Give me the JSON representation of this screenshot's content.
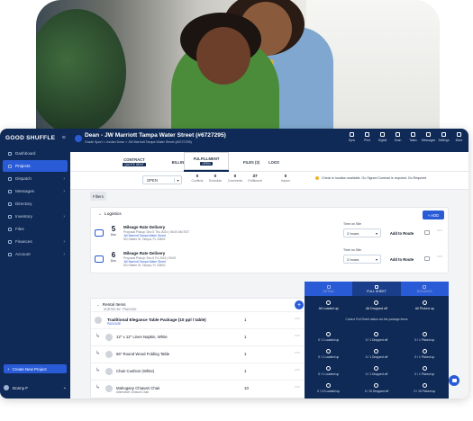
{
  "app": {
    "logo": "GOOD SHUFFLE"
  },
  "sidebar": {
    "items": [
      {
        "label": "Dashboard",
        "chev": ""
      },
      {
        "label": "Projects",
        "chev": ""
      },
      {
        "label": "Dispatch",
        "chev": "›"
      },
      {
        "label": "Messages",
        "chev": "›"
      },
      {
        "label": "Directory",
        "chev": ""
      },
      {
        "label": "Inventory",
        "chev": "›"
      },
      {
        "label": "Files",
        "chev": ""
      },
      {
        "label": "Finances",
        "chev": "›"
      },
      {
        "label": "Account",
        "chev": "›"
      }
    ],
    "create_label": "Create New Project",
    "user_label": "Donny F"
  },
  "project": {
    "title": "Dean - JW Marriott Tampa Water Street (#6727295)",
    "crumb": "Grade Sport > Jordan Dean > JW Marriott Tampa Water Street (#6727295)"
  },
  "toolbar": [
    "Sync",
    "Print",
    "Digital",
    "Scan",
    "Tasks",
    "Messages",
    "Settings",
    "More"
  ],
  "tabs": [
    {
      "label": "CONTRACT",
      "sub": "QUOTE SENT"
    },
    {
      "label": "BILLING",
      "sub": ""
    },
    {
      "label": "FULFILLMENT",
      "sub": "OPEN"
    },
    {
      "label": "FILES (3)",
      "sub": ""
    },
    {
      "label": "LOGS",
      "sub": ""
    }
  ],
  "status": {
    "value": "OPEN",
    "metrics": [
      {
        "value": "0",
        "label": "Conflicts"
      },
      {
        "value": "0",
        "label": "Schedule"
      },
      {
        "value": "0",
        "label": "Comments"
      },
      {
        "value": "37",
        "label": "Fulfillment"
      },
      {
        "value": "0",
        "label": "Issues"
      }
    ],
    "warning": "Check in location available. Go Signed Contract is required. Go Required"
  },
  "filters_label": "Filters",
  "logistics": {
    "title": "Logistics",
    "add_label": "+ ADD",
    "rows": [
      {
        "day": "5",
        "dow": "Dec",
        "title": "Mileage Rate Delivery",
        "l1": "Proposal Pickup: Dec 5 Thu 2024 | 06:00 AM EST",
        "l2": "JW Marriott Tampa Water Street",
        "l3": "510 Water St, Tampa, FL 33602",
        "time_label": "Time on Site",
        "time_value": "2 hours",
        "route_label": "Add to Route"
      },
      {
        "day": "6",
        "dow": "Dec",
        "title": "Mileage Rate Delivery",
        "l1": "Proposal Pickup: Dec 6 Fri 2024 | 09:00",
        "l2": "JW Marriott Tampa Water Street",
        "l3": "510 Water St, Tampa, FL 33602",
        "time_label": "Time on Site",
        "time_value": "2 hours",
        "route_label": "Add to Route"
      }
    ]
  },
  "items": {
    "title": "Rental Items",
    "sub": "SORTED BY: TRACKED",
    "rows": [
      {
        "name": "Traditional Elegance Table Package (10 ppl / table)",
        "sub": "PACKAGE",
        "qty": "1"
      },
      {
        "name": "12\" x 12\" Linen Napkin, White",
        "sub": "",
        "qty": "1"
      },
      {
        "name": "66\" Round Wood Folding Table",
        "sub": "",
        "qty": "1"
      },
      {
        "name": "Chair Cushion (White)",
        "sub": "",
        "qty": "1"
      },
      {
        "name": "Mahogany Chiavari Chair",
        "sub": "Alternative Chiavari Chair",
        "qty": "10"
      }
    ]
  },
  "fulfillment": {
    "tabs": [
      "DETAIL",
      "FULL SHEET",
      "BOOKING"
    ],
    "cols": [
      "All Loaded up",
      "All Dropped off",
      "All Picked up"
    ],
    "note": "Control Pull Sheet status via the package items",
    "rows": [
      [
        "0 / 1 Loaded up",
        "0 / 1 Dropped off",
        "0 / 1 Picked up"
      ],
      [
        "0 / 1 Loaded up",
        "0 / 1 Dropped off",
        "0 / 1 Picked up"
      ],
      [
        "0 / 1 Loaded up",
        "0 / 1 Dropped off",
        "0 / 1 Picked up"
      ],
      [
        "0 / 10 Loaded up",
        "0 / 10 Dropped off",
        "0 / 10 Picked up"
      ]
    ]
  }
}
